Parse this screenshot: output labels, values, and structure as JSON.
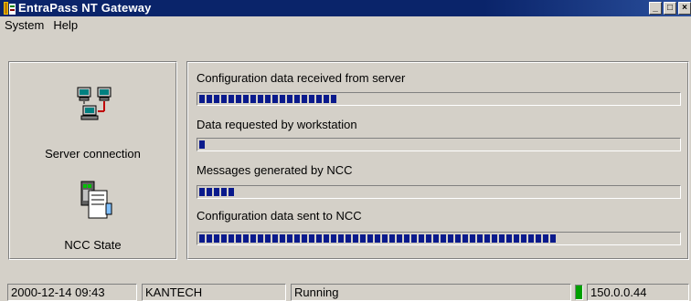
{
  "window": {
    "title": "EntraPass NT Gateway",
    "controls": {
      "minimize": "_",
      "maximize": "□",
      "close": "×"
    }
  },
  "menu": {
    "items": [
      "System",
      "Help"
    ]
  },
  "left_panel": {
    "server_connection_label": "Server connection",
    "ncc_state_label": "NCC State",
    "icons": [
      "network-computers-icon",
      "ncc-controller-icon"
    ]
  },
  "progress": [
    {
      "label": "Configuration data received from server",
      "fraction": 0.29
    },
    {
      "label": "Data requested by workstation",
      "fraction": 0.015
    },
    {
      "label": "Messages generated by NCC",
      "fraction": 0.08
    },
    {
      "label": "Configuration data sent to NCC",
      "fraction": 0.75
    }
  ],
  "statusbar": {
    "datetime": "2000-12-14  09:43",
    "company": "KANTECH",
    "state": "Running",
    "ip": "150.0.0.44",
    "led_color": "#00a000"
  },
  "colors": {
    "titlebar": "#0a246a",
    "progress_block": "#0a1a8c",
    "face": "#d4d0c8"
  }
}
